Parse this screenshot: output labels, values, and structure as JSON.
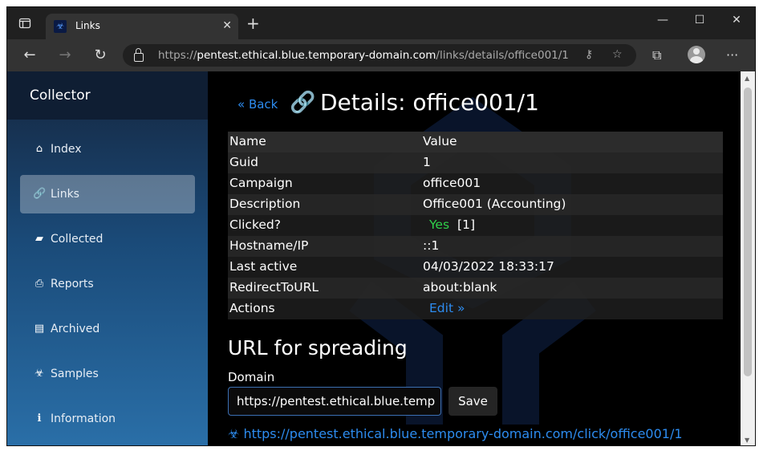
{
  "browser": {
    "tab_title": "Links",
    "url_scheme": "https://",
    "url_host": "pentest.ethical.blue.temporary-domain.com",
    "url_path": "/links/details/office001/1"
  },
  "sidebar": {
    "brand": "Collector",
    "items": [
      {
        "label": "Index",
        "icon": "home-icon"
      },
      {
        "label": "Links",
        "icon": "link-icon",
        "active": true
      },
      {
        "label": "Collected",
        "icon": "folder-icon"
      },
      {
        "label": "Reports",
        "icon": "print-icon"
      },
      {
        "label": "Archived",
        "icon": "archive-icon"
      },
      {
        "label": "Samples",
        "icon": "biohazard-icon"
      },
      {
        "label": "Information",
        "icon": "info-icon"
      }
    ]
  },
  "main": {
    "back_label": "« Back",
    "title": "Details: office001/1",
    "table_headers": {
      "name": "Name",
      "value": "Value"
    },
    "rows": {
      "guid": {
        "name": "Guid",
        "value": "1"
      },
      "campaign": {
        "name": "Campaign",
        "value": "office001"
      },
      "description": {
        "name": "Description",
        "value": "Office001 (Accounting)"
      },
      "clicked": {
        "name": "Clicked?",
        "value": "Yes",
        "count": "[1]"
      },
      "host": {
        "name": "Hostname/IP",
        "value": "::1"
      },
      "last_active": {
        "name": "Last active",
        "value": "04/03/2022 18:33:17"
      },
      "redirect": {
        "name": "RedirectToURL",
        "value": "about:blank"
      },
      "actions": {
        "name": "Actions",
        "value": "Edit »"
      }
    },
    "spreading": {
      "title": "URL for spreading",
      "domain_label": "Domain",
      "domain_value": "https://pentest.ethical.blue.temp",
      "save_label": "Save",
      "link": "https://pentest.ethical.blue.temporary-domain.com/click/office001/1"
    }
  },
  "colors": {
    "link": "#2d8cf0",
    "yes": "#2fd24a",
    "sidebar_active": "rgba(255,255,255,0.3)"
  }
}
